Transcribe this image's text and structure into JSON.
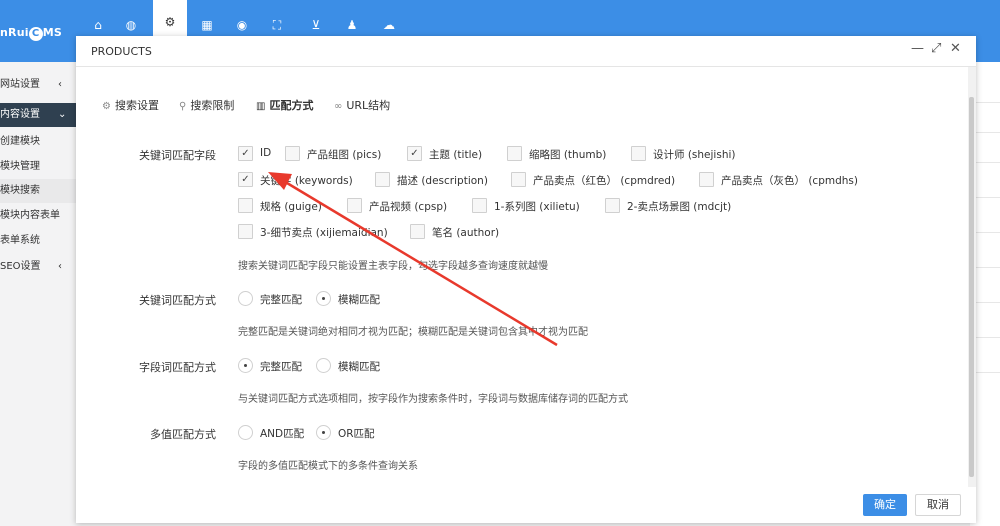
{
  "app": {
    "logo_prefix": "nRui",
    "logo_mark": "C",
    "logo_suffix": "MS"
  },
  "topnav": {
    "icons": [
      "home-icon",
      "globe-icon",
      "gears-icon",
      "grid-icon",
      "user-circle-icon",
      "sitemap-icon",
      "cart-icon",
      "user-icon",
      "cloud-icon"
    ],
    "active_icon": "gears-icon",
    "color": "#3c8ee6"
  },
  "sidebar": {
    "items": [
      {
        "label": "网站设置",
        "arrow": "‹"
      },
      {
        "label": "内容设置",
        "arrow": "⌄"
      },
      {
        "label": "创建模块"
      },
      {
        "label": "模块管理"
      },
      {
        "label": "模块搜索"
      },
      {
        "label": "模块内容表单"
      },
      {
        "label": "表单系统"
      },
      {
        "label": "SEO设置",
        "arrow": "‹"
      }
    ]
  },
  "modal": {
    "title": "PRODUCTS",
    "controls": {
      "minimize": "—",
      "maximize": "⤢",
      "close": "✕"
    },
    "tabs": [
      {
        "label": "搜索设置",
        "icon": "gear-icon"
      },
      {
        "label": "搜索限制",
        "icon": "search-icon"
      },
      {
        "label": "匹配方式",
        "icon": "map-icon"
      },
      {
        "label": "URL结构",
        "icon": "link-icon"
      }
    ],
    "active_tab": "匹配方式",
    "keyword_fields": {
      "label": "关键词匹配字段",
      "options": [
        {
          "label": "ID",
          "checked": true
        },
        {
          "label": "产品组图  (pics)",
          "checked": false
        },
        {
          "label": "主题  (title)",
          "checked": true
        },
        {
          "label": "缩略图  (thumb)",
          "checked": false
        },
        {
          "label": "设计师  (shejishi)",
          "checked": false
        },
        {
          "label": "关键字  (keywords)",
          "checked": true
        },
        {
          "label": "描述  (description)",
          "checked": false
        },
        {
          "label": "产品卖点（红色）  (cpmdred)",
          "checked": false
        },
        {
          "label": "产品卖点（灰色）  (cpmdhs)",
          "checked": false
        },
        {
          "label": "规格  (guige)",
          "checked": false
        },
        {
          "label": "产品视频  (cpsp)",
          "checked": false
        },
        {
          "label": "1-系列图  (xilietu)",
          "checked": false
        },
        {
          "label": "2-卖点场景图  (mdcjt)",
          "checked": false
        },
        {
          "label": "3-细节卖点  (xijiemaidian)",
          "checked": false
        },
        {
          "label": "笔名  (author)",
          "checked": false
        }
      ],
      "help": "搜索关键词匹配字段只能设置主表字段，勾选字段越多查询速度就越慢"
    },
    "keyword_match": {
      "label": "关键词匹配方式",
      "options": [
        {
          "label": "完整匹配",
          "selected": false
        },
        {
          "label": "模糊匹配",
          "selected": true
        }
      ],
      "help": "完整匹配是关键词绝对相同才视为匹配；模糊匹配是关键词包含其中才视为匹配"
    },
    "field_match": {
      "label": "字段词匹配方式",
      "options": [
        {
          "label": "完整匹配",
          "selected": true
        },
        {
          "label": "模糊匹配",
          "selected": false
        }
      ],
      "help": "与关键词匹配方式选项相同，按字段作为搜索条件时，字段词与数据库储存词的匹配方式"
    },
    "multi_match": {
      "label": "多值匹配方式",
      "options": [
        {
          "label": "AND匹配",
          "selected": false
        },
        {
          "label": "OR匹配",
          "selected": true
        }
      ],
      "help": "字段的多值匹配模式下的多条件查询关系"
    },
    "footer": {
      "confirm": "确定",
      "cancel": "取消"
    }
  },
  "annotation": {
    "color": "#e8392c"
  }
}
